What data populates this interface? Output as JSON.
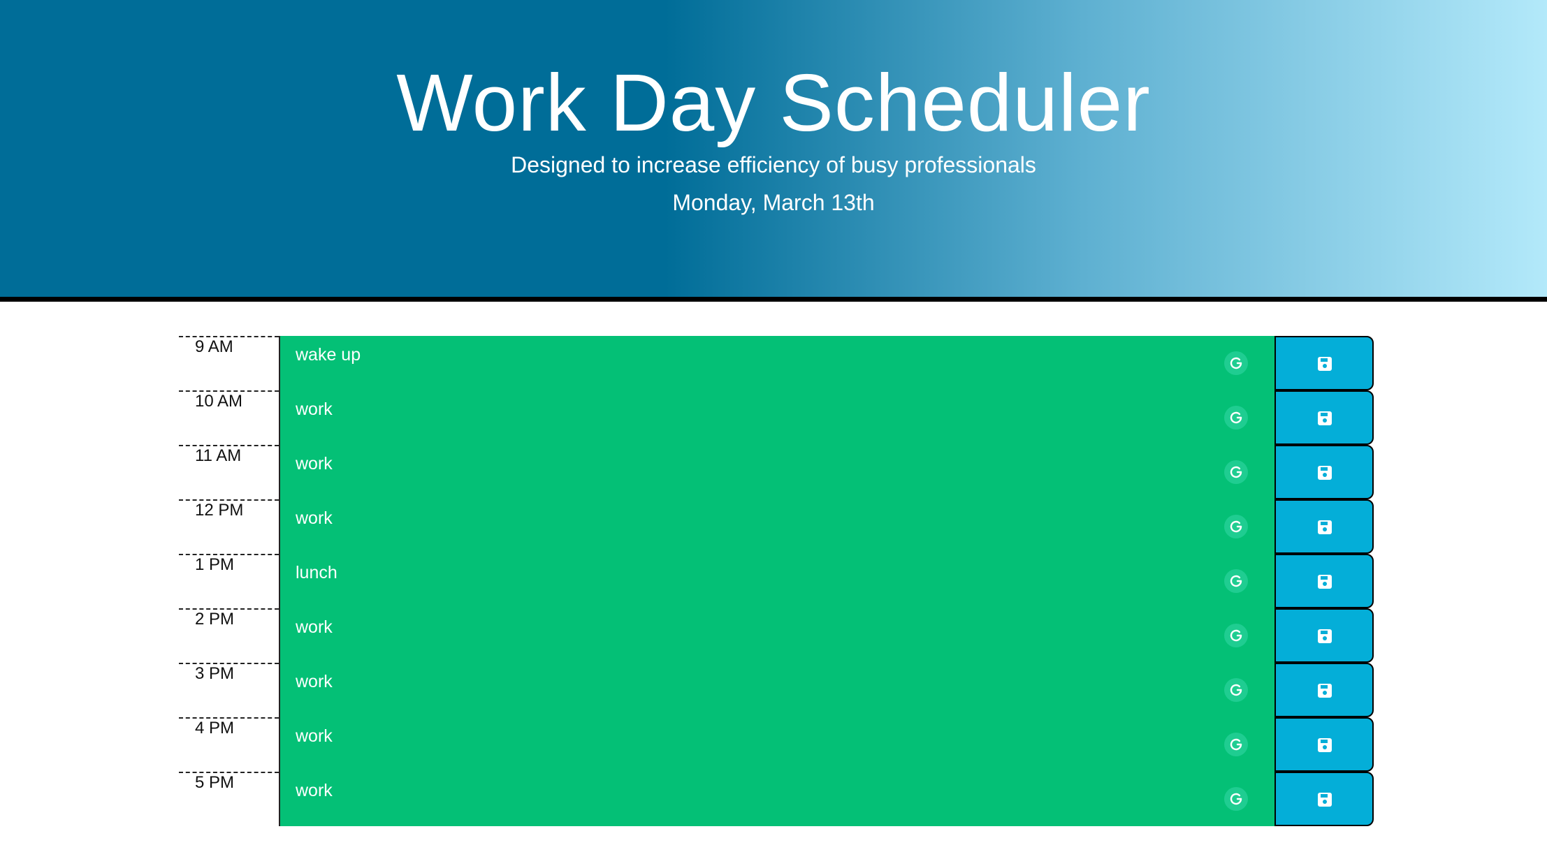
{
  "header": {
    "title": "Work Day Scheduler",
    "subtitle": "Designed to increase efficiency of busy professionals",
    "date": "Monday, March 13th"
  },
  "schedule": [
    {
      "hour": "9 AM",
      "task": "wake up"
    },
    {
      "hour": "10 AM",
      "task": "work"
    },
    {
      "hour": "11 AM",
      "task": "work"
    },
    {
      "hour": "12 PM",
      "task": "work"
    },
    {
      "hour": "1 PM",
      "task": "lunch"
    },
    {
      "hour": "2 PM",
      "task": "work"
    },
    {
      "hour": "3 PM",
      "task": "work"
    },
    {
      "hour": "4 PM",
      "task": "work"
    },
    {
      "hour": "5 PM",
      "task": "work"
    }
  ],
  "icons": {
    "row_action": "refresh-icon",
    "save": "save-icon"
  },
  "colors": {
    "header_start": "#006d98",
    "header_end": "#b3e9fa",
    "task_present": "#04c076",
    "save_button": "#04aed8"
  }
}
